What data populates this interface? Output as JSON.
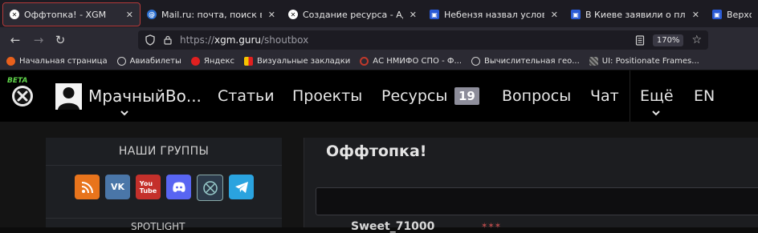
{
  "tabs": [
    {
      "title": "Оффтопка! - XGM",
      "favicon": "xgm-icon",
      "active": true,
      "close": "✕"
    },
    {
      "title": "Mail.ru: почта, поиск в интерн",
      "favicon": "mail-icon",
      "active": false,
      "close": "✕"
    },
    {
      "title": "Создание ресурса - Админист",
      "favicon": "xgm-icon",
      "active": false,
      "close": "✕"
    },
    {
      "title": "Небензя назвал условия для з",
      "favicon": "news-icon",
      "active": false,
      "close": "✕"
    },
    {
      "title": "В Киеве заявили о планах Фра",
      "favicon": "news-icon",
      "active": false,
      "close": "✕"
    },
    {
      "title": "Верховны",
      "favicon": "news-icon",
      "active": false,
      "close": ""
    }
  ],
  "navbar": {
    "url_prefix": "https://",
    "url_host": "xgm.guru",
    "url_path": "/shoutbox",
    "zoom": "170%"
  },
  "bookmarks": [
    {
      "label": "Начальная страница",
      "icon": "firefox-icon"
    },
    {
      "label": "Авиабилеты",
      "icon": "globe-icon"
    },
    {
      "label": "Яндекс",
      "icon": "yandex-icon"
    },
    {
      "label": "Визуальные закладки",
      "icon": "bookmark-flag-icon"
    },
    {
      "label": "АС НМИФО СПО - Ф...",
      "icon": "circle-logo-icon"
    },
    {
      "label": "Вычислительная гео...",
      "icon": "globe-icon"
    },
    {
      "label": "UI: Positionate Frames...",
      "icon": "image-icon"
    }
  ],
  "site": {
    "beta": "BETA",
    "username": "МрачныйВо...",
    "nav": [
      {
        "label": "Статьи"
      },
      {
        "label": "Проекты"
      },
      {
        "label": "Ресурсы"
      },
      {
        "label": "Вопросы"
      },
      {
        "label": "Чат"
      },
      {
        "label": "Ещё"
      },
      {
        "label": "EN"
      }
    ],
    "resources_count": "19"
  },
  "left_panel": {
    "heading": "НАШИ ГРУППЫ",
    "socials": [
      "rss-icon",
      "vk-icon",
      "youtube-icon",
      "discord-icon",
      "xgm-social-icon",
      "telegram-icon"
    ],
    "next_heading": "SPOTLIGHT"
  },
  "main_panel": {
    "title": "Оффтопка!",
    "first_row": "Sweet_71000"
  },
  "colors": {
    "active_tab_border": "#b43a3a",
    "badge": "#8d8d9a",
    "beta": "#5fd34a"
  }
}
